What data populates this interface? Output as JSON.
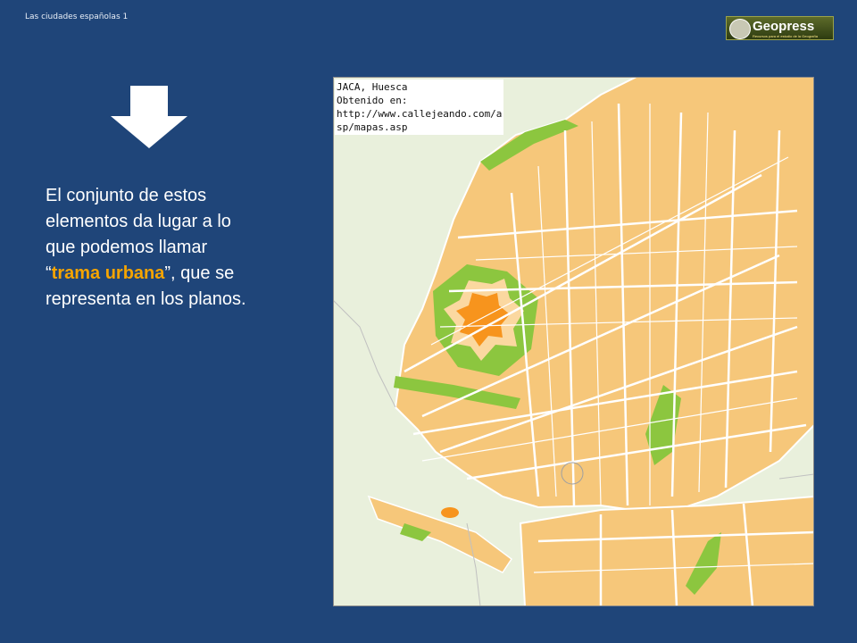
{
  "header": {
    "title": "Las ciudades españolas 1"
  },
  "logo": {
    "name": "Geopress",
    "tagline": "Recursos para el estudio de la Geografía"
  },
  "body": {
    "lines": [
      "El conjunto de estos",
      "elementos da lugar a lo",
      "que podemos llamar"
    ],
    "quote_open": "“",
    "highlight": "trama urbana",
    "after_highlight": "”, que se",
    "last_line": "representa en los planos."
  },
  "map": {
    "note_lines": [
      "JACA, Huesca",
      "Obtenido en:",
      "http://www.callejeando.com/a",
      "sp/mapas.asp"
    ]
  },
  "colors": {
    "background": "#1f4579",
    "highlight": "#f5a400",
    "block": "#f6c77a",
    "park": "#8cc63f",
    "fortress": "#f7941d"
  }
}
